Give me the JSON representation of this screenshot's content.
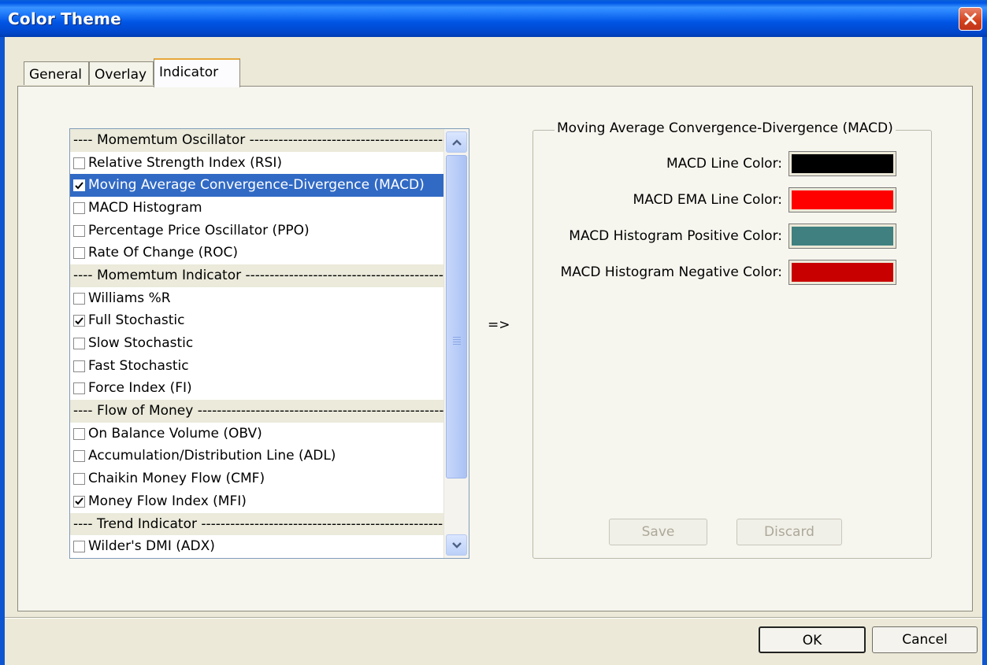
{
  "window": {
    "title": "Color Theme"
  },
  "tabs": [
    {
      "label": "General",
      "active": false
    },
    {
      "label": "Overlay",
      "active": false
    },
    {
      "label": "Indicator",
      "active": true
    }
  ],
  "indicator_list": {
    "rows": [
      {
        "type": "group",
        "label": "---- Momemtum Oscillator ------------------------------------------------------------"
      },
      {
        "type": "item",
        "label": "Relative Strength Index (RSI)",
        "checked": false,
        "selected": false
      },
      {
        "type": "item",
        "label": "Moving Average Convergence-Divergence (MACD)",
        "checked": true,
        "selected": true
      },
      {
        "type": "item",
        "label": "MACD Histogram",
        "checked": false,
        "selected": false
      },
      {
        "type": "item",
        "label": "Percentage Price Oscillator (PPO)",
        "checked": false,
        "selected": false
      },
      {
        "type": "item",
        "label": "Rate Of Change (ROC)",
        "checked": false,
        "selected": false
      },
      {
        "type": "group",
        "label": "---- Momemtum Indicator ---------------------------------------------------------------"
      },
      {
        "type": "item",
        "label": "Williams %R",
        "checked": false,
        "selected": false
      },
      {
        "type": "item",
        "label": "Full Stochastic",
        "checked": true,
        "selected": false
      },
      {
        "type": "item",
        "label": "Slow Stochastic",
        "checked": false,
        "selected": false
      },
      {
        "type": "item",
        "label": "Fast Stochastic",
        "checked": false,
        "selected": false
      },
      {
        "type": "item",
        "label": "Force Index (FI)",
        "checked": false,
        "selected": false
      },
      {
        "type": "group",
        "label": "---- Flow of Money ----------------------------------------------------------------------"
      },
      {
        "type": "item",
        "label": "On Balance Volume (OBV)",
        "checked": false,
        "selected": false
      },
      {
        "type": "item",
        "label": "Accumulation/Distribution Line (ADL)",
        "checked": false,
        "selected": false
      },
      {
        "type": "item",
        "label": "Chaikin Money Flow (CMF)",
        "checked": false,
        "selected": false
      },
      {
        "type": "item",
        "label": "Money Flow Index (MFI)",
        "checked": true,
        "selected": false
      },
      {
        "type": "group",
        "label": "---- Trend Indicator ---------------------------------------------------------------------"
      },
      {
        "type": "item",
        "label": "Wilder's DMI (ADX)",
        "checked": false,
        "selected": false
      }
    ]
  },
  "arrow_label": "=>",
  "macd_panel": {
    "legend": "Moving Average Convergence-Divergence (MACD)",
    "colors": [
      {
        "label": "MACD Line Color:",
        "color": "#000000"
      },
      {
        "label": "MACD EMA Line Color:",
        "color": "#ff0000"
      },
      {
        "label": "MACD Histogram Positive Color:",
        "color": "#408080"
      },
      {
        "label": "MACD Histogram Negative Color:",
        "color": "#c80000"
      }
    ],
    "save_label": "Save",
    "discard_label": "Discard"
  },
  "footer": {
    "ok_label": "OK",
    "cancel_label": "Cancel"
  }
}
